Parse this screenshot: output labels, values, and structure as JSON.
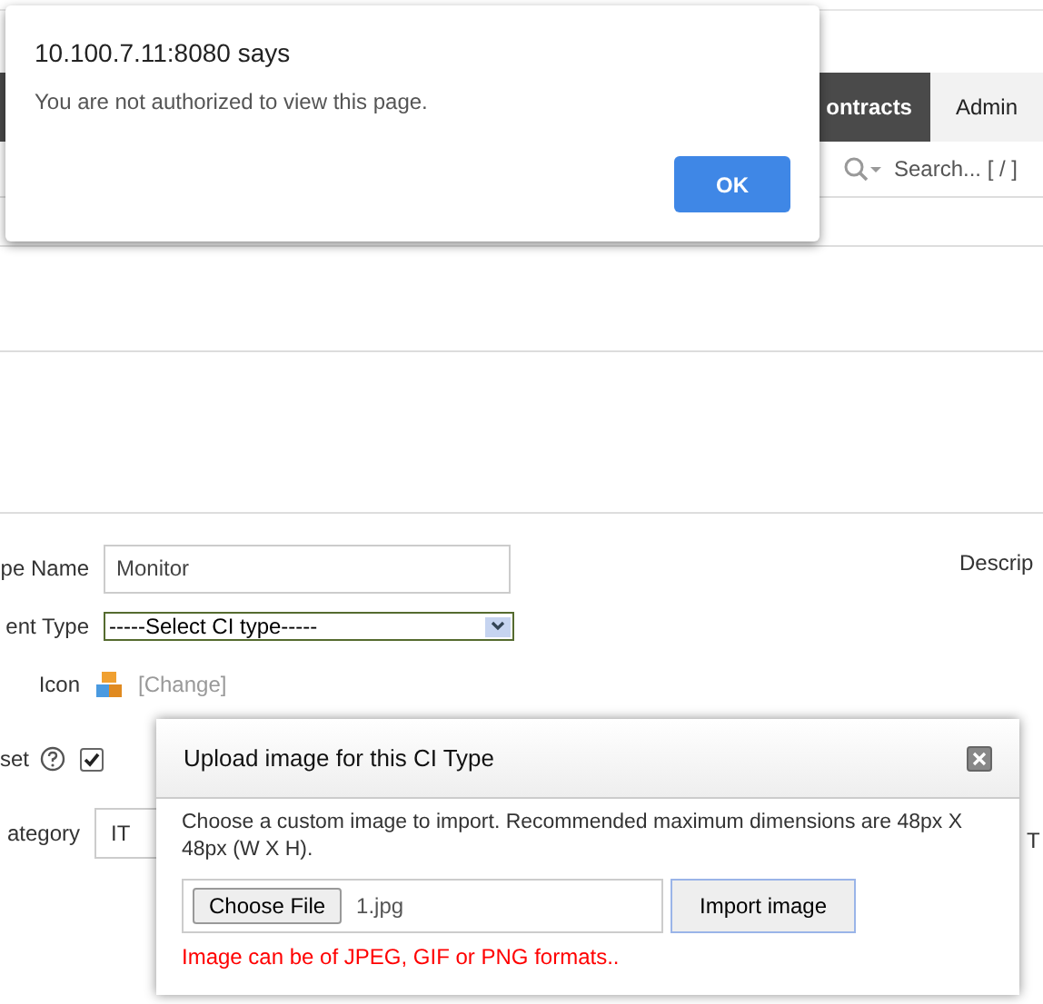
{
  "nav": {
    "tabs": [
      {
        "label": "ontracts",
        "selected": false
      },
      {
        "label": "Admin",
        "selected": true
      }
    ]
  },
  "search": {
    "placeholder": "Search... [ / ]"
  },
  "form": {
    "name_label": "pe Name",
    "name_value": "Monitor",
    "parent_label": "ent Type",
    "parent_value": "-----Select CI type-----",
    "icon_label": "Icon",
    "change_link": "[Change]",
    "asset_label": "set",
    "asset_checked": true,
    "category_label": "ategory",
    "category_value": "IT",
    "description_label": "Descrip",
    "right_label": "T"
  },
  "alert": {
    "title": "10.100.7.11:8080 says",
    "message": "You are not authorized to view this page.",
    "button": "OK"
  },
  "modal": {
    "title": "Upload image for this CI Type",
    "text": "Choose a custom image to import. Recommended maximum dimensions are 48px X 48px (W X H).",
    "choose_button": "Choose File",
    "file_name": "1.jpg",
    "import_button": "Import image",
    "note": "Image can be of JPEG, GIF or PNG formats.."
  }
}
